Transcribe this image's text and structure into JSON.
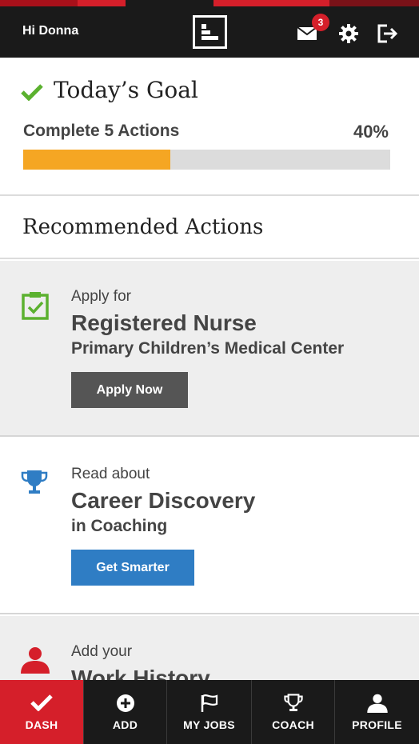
{
  "header": {
    "greeting": "Hi Donna",
    "mail_badge": "3",
    "icons": [
      "mail-icon",
      "gear-icon",
      "logout-icon",
      "logo-icon"
    ],
    "stripe_colors": [
      "#d51f2a",
      "#8b1a1a",
      "#1a1a1a"
    ]
  },
  "goal": {
    "title": "Today’s Goal",
    "subtitle": "Complete 5 Actions",
    "percent_label": "40%",
    "progress": 0.4,
    "progress_color": "#f5a623",
    "check_color": "#5bb12f"
  },
  "recommended": {
    "heading": "Recommended Actions"
  },
  "cards": [
    {
      "icon": "clipboard-check-icon",
      "icon_color": "#5bb12f",
      "line1": "Apply for",
      "line2": "Registered Nurse",
      "line3": "Primary Children’s Medical Center",
      "button": "Apply Now",
      "button_color": "#555555",
      "background": "#eeeeee"
    },
    {
      "icon": "trophy-icon",
      "icon_color": "#2f7dc4",
      "line1": "Read about",
      "line2": "Career Discovery",
      "line3": "in Coaching",
      "button": "Get Smarter",
      "button_color": "#2f7dc4",
      "background": "#ffffff"
    },
    {
      "icon": "user-icon",
      "icon_color": "#d51f2a",
      "line1": "Add your",
      "line2": "Work History",
      "background": "#eeeeee"
    }
  ],
  "tabs": [
    {
      "label": "DASH",
      "icon": "check-icon",
      "active": true
    },
    {
      "label": "ADD",
      "icon": "plus-circle-icon",
      "active": false
    },
    {
      "label": "MY JOBS",
      "icon": "flag-icon",
      "active": false
    },
    {
      "label": "COACH",
      "icon": "trophy-icon",
      "active": false
    },
    {
      "label": "PROFILE",
      "icon": "user-icon",
      "active": false
    }
  ]
}
